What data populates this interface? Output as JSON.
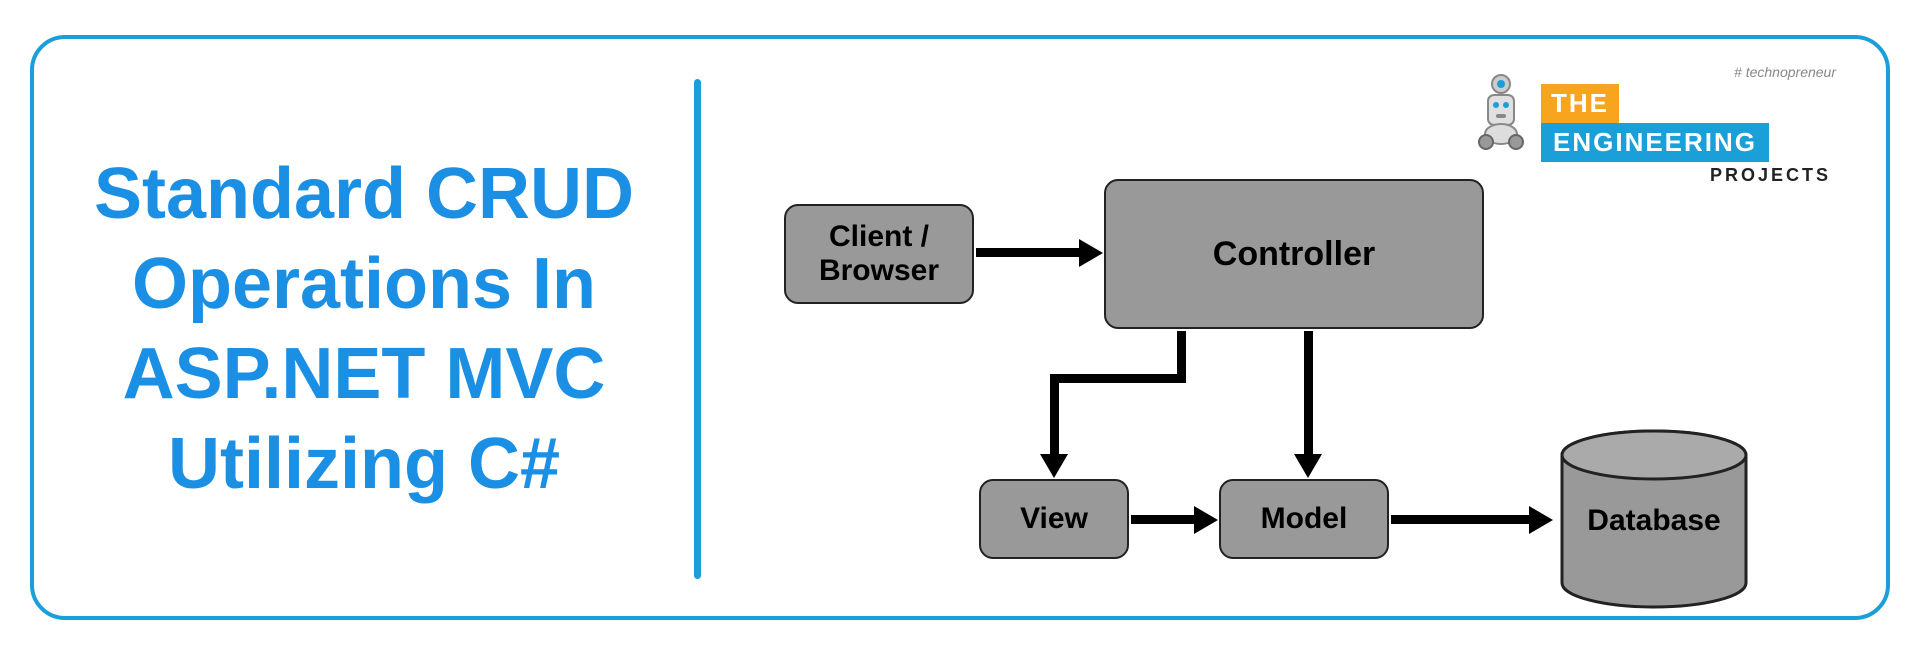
{
  "title": "Standard CRUD Operations In ASP.NET MVC Utilizing C#",
  "logo": {
    "tagline": "# technopreneur",
    "the": "THE",
    "engineering": "ENGINEERING",
    "projects": "PROJECTS"
  },
  "diagram": {
    "nodes": {
      "client": "Client / Browser",
      "controller": "Controller",
      "view": "View",
      "model": "Model",
      "database": "Database"
    },
    "edges": [
      {
        "from": "client",
        "to": "controller"
      },
      {
        "from": "controller",
        "to": "view"
      },
      {
        "from": "controller",
        "to": "model"
      },
      {
        "from": "view",
        "to": "model"
      },
      {
        "from": "model",
        "to": "database"
      }
    ]
  }
}
